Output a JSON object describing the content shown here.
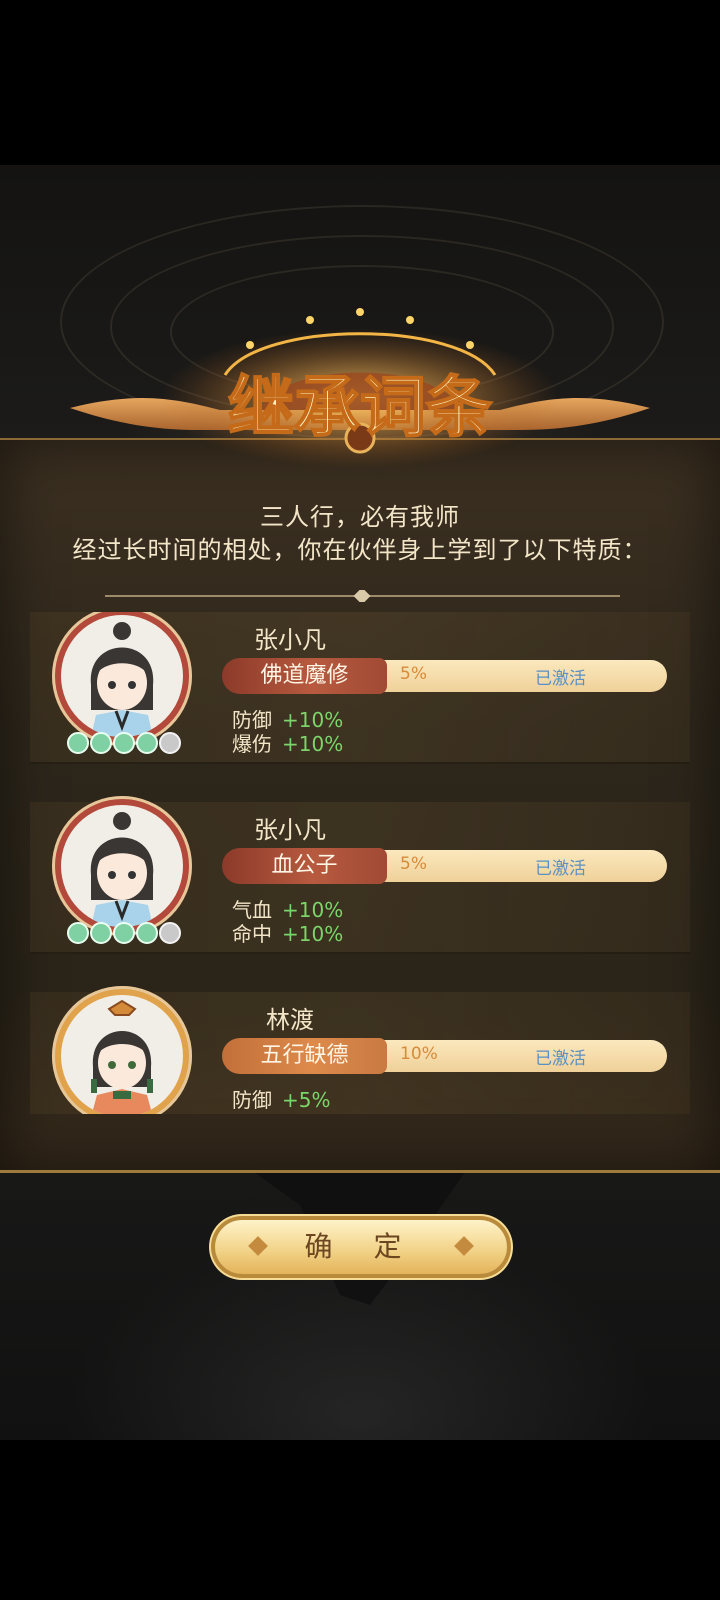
{
  "title": "继承词条",
  "subtitle_lines": [
    "三人行，必有我师",
    "经过长时间的相处，你在伙伴身上学到了以下特质："
  ],
  "entries": [
    {
      "name": "张小凡",
      "trait": "佛道魔修",
      "percent": "5%",
      "status": "已激活",
      "stats": [
        {
          "label": "防御",
          "value": "+10%"
        },
        {
          "label": "爆伤",
          "value": "+10%"
        }
      ],
      "gems_filled": 4,
      "gems_total": 5
    },
    {
      "name": "张小凡",
      "trait": "血公子",
      "percent": "5%",
      "status": "已激活",
      "stats": [
        {
          "label": "气血",
          "value": "+10%"
        },
        {
          "label": "命中",
          "value": "+10%"
        }
      ],
      "gems_filled": 4,
      "gems_total": 5
    },
    {
      "name": "林渡",
      "trait": "五行缺德",
      "percent": "10%",
      "status": "已激活",
      "stats": [
        {
          "label": "防御",
          "value": "+5%"
        }
      ]
    }
  ],
  "confirm_label": "确 定",
  "colors": {
    "accent_gold": "#f2d48a",
    "status_blue": "#5a8fc3",
    "stat_green": "#7bd56a",
    "trait_red": "#b75a3f",
    "trait_orange": "#dd8a4b"
  }
}
